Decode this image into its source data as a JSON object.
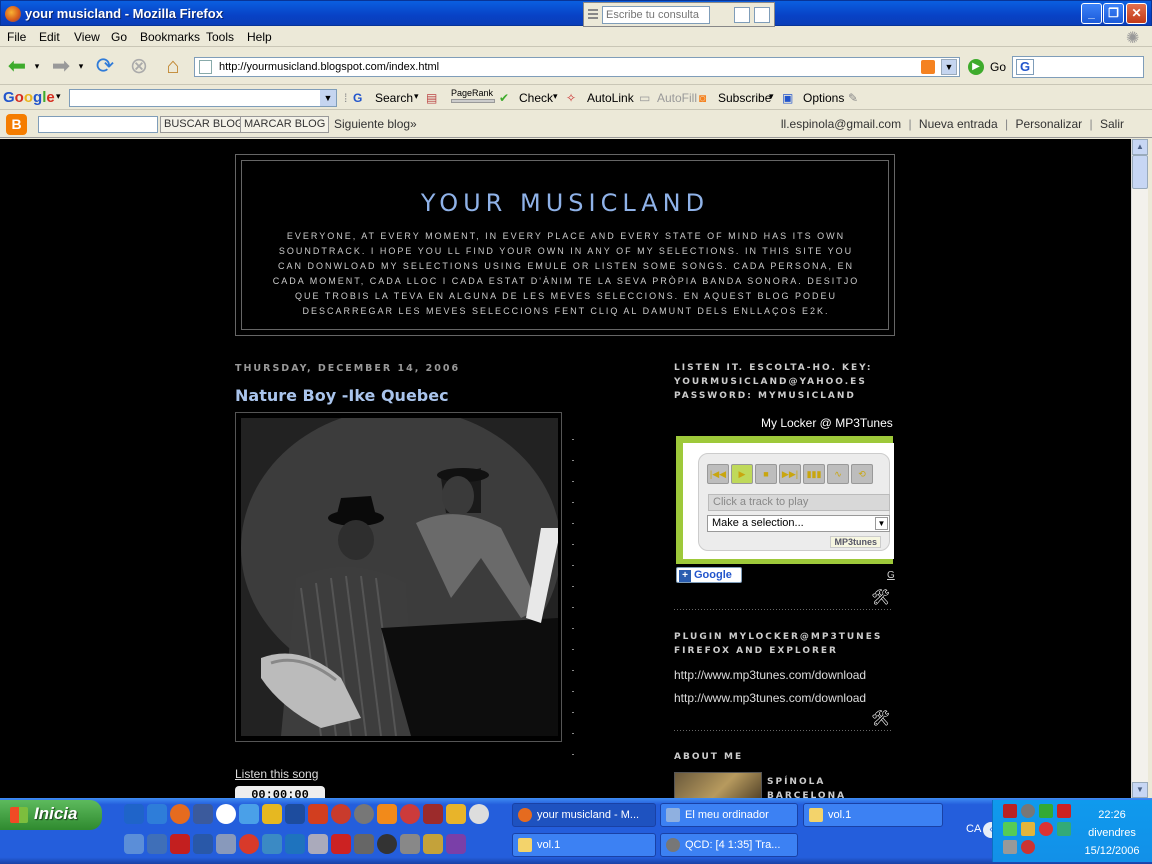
{
  "window": {
    "title": "your musicland - Mozilla Firefox",
    "search_placeholder": "Escribe tu consulta",
    "controls": {
      "minimize": "_",
      "maximize": "❐",
      "close": "✕"
    }
  },
  "menubar": [
    "File",
    "Edit",
    "View",
    "Go",
    "Bookmarks",
    "Tools",
    "Help"
  ],
  "navbar": {
    "url": "http://yourmusicland.blogspot.com/index.html",
    "go_label": "Go",
    "search_value": ""
  },
  "google_toolbar": {
    "logo": "Google",
    "search_label": "Search",
    "pagerank_label": "PageRank",
    "check_label": "Check",
    "autolink_label": "AutoLink",
    "autofill_label": "AutoFill",
    "subscribe_label": "Subscribe",
    "options_label": "Options"
  },
  "blogger_bar": {
    "search_button": "BUSCAR BLOG",
    "flag_button": "MARCAR BLOG",
    "next_blog": "Siguiente blog»",
    "user_email": "ll.espinola@gmail.com",
    "new_post": "Nueva entrada",
    "customize": "Personalizar",
    "logout": "Salir",
    "separator": "|"
  },
  "blog": {
    "title": "YOUR MUSICLAND",
    "description": "EVERYONE, AT EVERY MOMENT, IN EVERY PLACE AND EVERY STATE OF MIND HAS ITS OWN SOUNDTRACK. I HOPE YOU LL FIND YOUR OWN IN ANY OF MY SELECTIONS. IN THIS SITE YOU CAN DONWLOAD MY SELECTIONS USING EMULE OR LISTEN SOME SONGS. CADA PERSONA, EN CADA MOMENT, CADA LLOC I CADA ESTAT D'ÀNIM TE LA SEVA PRÒPIA BANDA SONORA. DESITJO QUE TROBIS LA TEVA EN ALGUNA DE LES MEVES SELECCIONS. EN AQUEST BLOG PODEU DESCARREGAR LES MEVES SELECCIONS FENT CLIQ AL DAMUNT DELS ENLLAÇOS E2K.",
    "post_date": "THURSDAY, DECEMBER 14, 2006",
    "post_title": "Nature Boy -Ike Quebec",
    "listen_link": "Listen this song",
    "timer": "00:00:00"
  },
  "sidebar": {
    "listen_heading": "LISTEN IT. ESCOLTA-HO. KEY: YOURMUSICLAND@YAHOO.ES PASSWORD: MYMUSICLAND",
    "locker_label": "My Locker @ MP3Tunes",
    "player": {
      "track_placeholder": "Click a track to play",
      "selection": "Make a selection...",
      "brand": "MP3tunes",
      "controls": [
        "|◀◀",
        "▶",
        "■",
        "▶▶|",
        "▮▮▮",
        "∿",
        "⟲"
      ]
    },
    "add_google": "Google",
    "g_link": "G",
    "plugin_heading": "PLUGIN MYLOCKER@MP3TUNES FIREFOX AND EXPLORER",
    "links": [
      "http://www.mp3tunes.com/download",
      "http://www.mp3tunes.com/download"
    ],
    "about_heading": "ABOUT ME",
    "about_name": "SPÍNOLA BARCELONA"
  },
  "taskbar": {
    "start_label": "Inicia",
    "tasks_row1": [
      "your musicland - M...",
      "El meu ordinador",
      "vol.1"
    ],
    "tasks_row2": [
      "vol.1",
      "QCD: [4 1:35] Tra..."
    ],
    "lang": "CA",
    "time": "22:26",
    "day": "divendres",
    "date": "15/12/2006"
  },
  "colors": {
    "accent": "#245EDC",
    "blog_title": "#8FB2E8",
    "widget_green": "#9EC93A"
  }
}
